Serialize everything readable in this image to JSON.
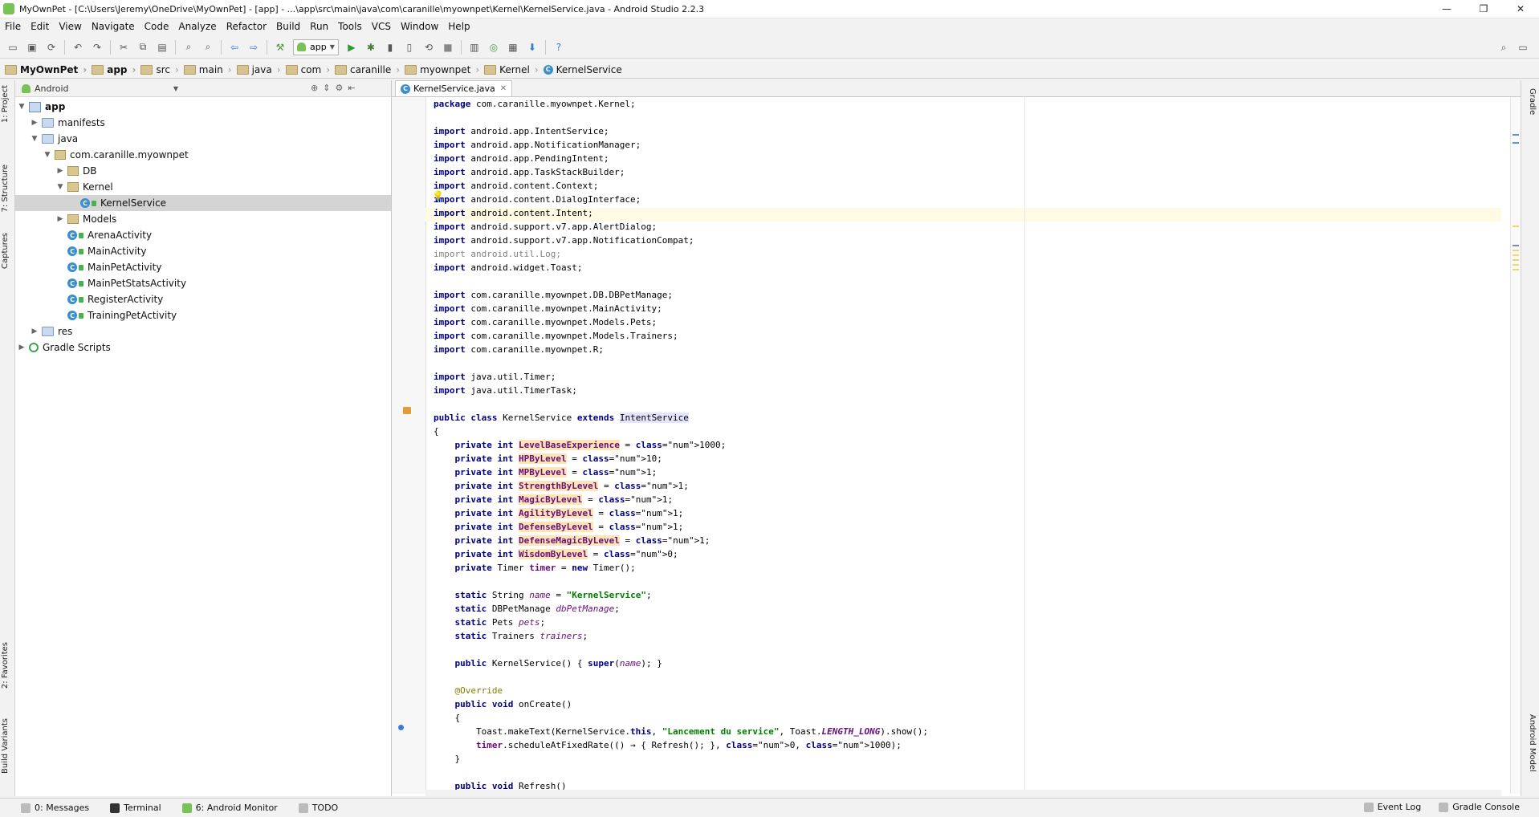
{
  "window": {
    "title": "MyOwnPet - [C:\\Users\\Jeremy\\OneDrive\\MyOwnPet] - [app] - ...\\app\\src\\main\\java\\com\\caranille\\myownpet\\Kernel\\KernelService.java - Android Studio 2.2.3",
    "minimize": "—",
    "maximize": "❐",
    "close": "✕"
  },
  "menu": [
    "File",
    "Edit",
    "View",
    "Navigate",
    "Code",
    "Analyze",
    "Refactor",
    "Build",
    "Run",
    "Tools",
    "VCS",
    "Window",
    "Help"
  ],
  "toolbar": {
    "run_config": "app"
  },
  "breadcrumbs": [
    "MyOwnPet",
    "app",
    "src",
    "main",
    "java",
    "com",
    "caranille",
    "myownpet",
    "Kernel",
    "KernelService"
  ],
  "left_tabs": [
    "1: Project",
    "7: Structure",
    "Captures",
    "2: Favorites",
    "Build Variants"
  ],
  "right_tabs": [
    "Gradle",
    "Android Model"
  ],
  "project_panel": {
    "view": "Android",
    "tree": [
      {
        "label": "app",
        "depth": 0,
        "icon": "module",
        "arrow": "▼",
        "bold": true
      },
      {
        "label": "manifests",
        "depth": 1,
        "icon": "folder",
        "arrow": "▶"
      },
      {
        "label": "java",
        "depth": 1,
        "icon": "folder",
        "arrow": "▼"
      },
      {
        "label": "com.caranille.myownpet",
        "depth": 2,
        "icon": "package",
        "arrow": "▼"
      },
      {
        "label": "DB",
        "depth": 3,
        "icon": "package",
        "arrow": "▶"
      },
      {
        "label": "Kernel",
        "depth": 3,
        "icon": "package",
        "arrow": "▼"
      },
      {
        "label": "KernelService",
        "depth": 4,
        "icon": "class",
        "arrow": "",
        "selected": true
      },
      {
        "label": "Models",
        "depth": 3,
        "icon": "package",
        "arrow": "▶"
      },
      {
        "label": "ArenaActivity",
        "depth": 3,
        "icon": "class",
        "arrow": ""
      },
      {
        "label": "MainActivity",
        "depth": 3,
        "icon": "class",
        "arrow": ""
      },
      {
        "label": "MainPetActivity",
        "depth": 3,
        "icon": "class",
        "arrow": ""
      },
      {
        "label": "MainPetStatsActivity",
        "depth": 3,
        "icon": "class",
        "arrow": ""
      },
      {
        "label": "RegisterActivity",
        "depth": 3,
        "icon": "class",
        "arrow": ""
      },
      {
        "label": "TrainingPetActivity",
        "depth": 3,
        "icon": "class",
        "arrow": ""
      },
      {
        "label": "res",
        "depth": 1,
        "icon": "folder",
        "arrow": "▶"
      },
      {
        "label": "Gradle Scripts",
        "depth": 0,
        "icon": "gradle",
        "arrow": "▶"
      }
    ]
  },
  "editor": {
    "tab": "KernelService.java",
    "lines": [
      "package com.caranille.myownpet.Kernel;",
      "",
      "import android.app.IntentService;",
      "import android.app.NotificationManager;",
      "import android.app.PendingIntent;",
      "import android.app.TaskStackBuilder;",
      "import android.content.Context;",
      "import android.content.DialogInterface;",
      "import android.content.Intent;",
      "import android.support.v7.app.AlertDialog;",
      "import android.support.v7.app.NotificationCompat;",
      "import android.util.Log;",
      "import android.widget.Toast;",
      "",
      "import com.caranille.myownpet.DB.DBPetManage;",
      "import com.caranille.myownpet.MainActivity;",
      "import com.caranille.myownpet.Models.Pets;",
      "import com.caranille.myownpet.Models.Trainers;",
      "import com.caranille.myownpet.R;",
      "",
      "import java.util.Timer;",
      "import java.util.TimerTask;",
      "",
      "public class KernelService extends IntentService",
      "{",
      "    private int LevelBaseExperience = 1000;",
      "    private int HPByLevel = 10;",
      "    private int MPByLevel = 1;",
      "    private int StrengthByLevel = 1;",
      "    private int MagicByLevel = 1;",
      "    private int AgilityByLevel = 1;",
      "    private int DefenseByLevel = 1;",
      "    private int DefenseMagicByLevel = 1;",
      "    private int WisdomByLevel = 0;",
      "    private Timer timer = new Timer();",
      "",
      "    static String name = \"KernelService\";",
      "    static DBPetManage dbPetManage;",
      "    static Pets pets;",
      "    static Trainers trainers;",
      "",
      "    public KernelService() { super(name); }",
      "",
      "    @Override",
      "    public void onCreate()",
      "    {",
      "        Toast.makeText(KernelService.this, \"Lancement du service\", Toast.LENGTH_LONG).show();",
      "        timer.scheduleAtFixedRate(() → { Refresh(); }, 0, 1000);",
      "    }",
      "",
      "    public void Refresh()"
    ]
  },
  "status": {
    "left": [
      "0: Messages",
      "Terminal",
      "6: Android Monitor",
      "TODO"
    ],
    "right": [
      "Event Log",
      "Gradle Console"
    ]
  }
}
